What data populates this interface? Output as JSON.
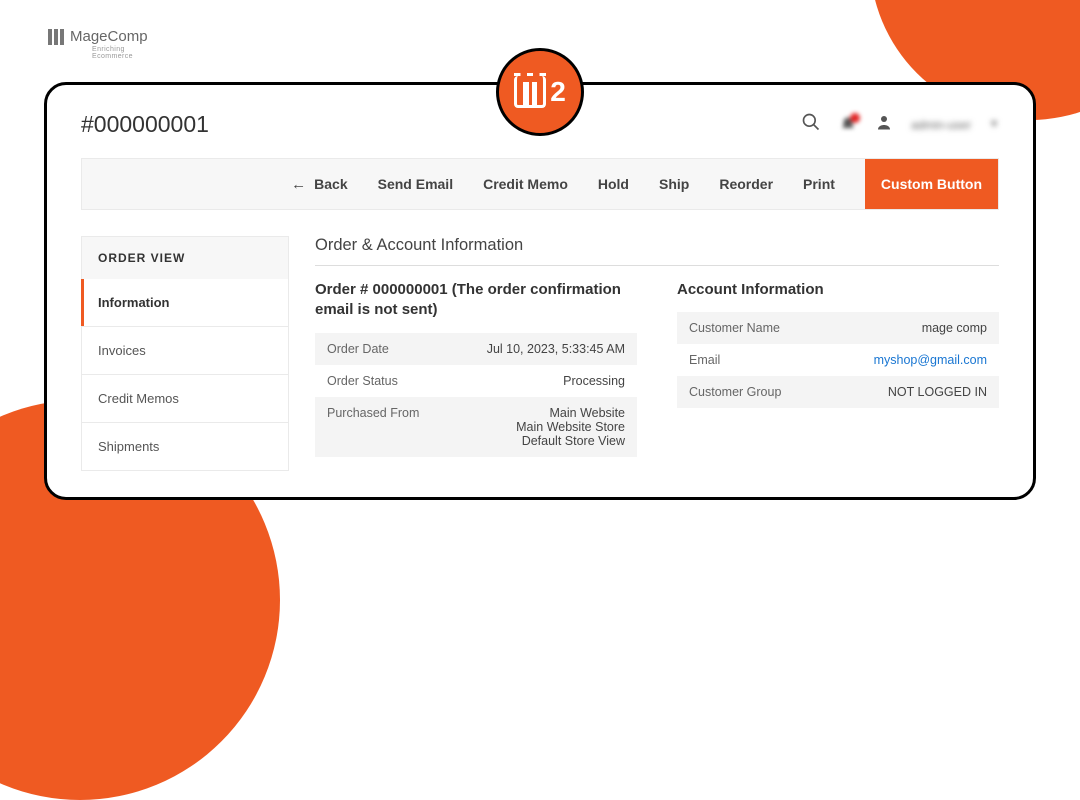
{
  "header": {
    "page_title": "#000000001",
    "user_label": "admin-user"
  },
  "badge": {
    "suffix": "2"
  },
  "logo": {
    "text": "MageComp",
    "sub": "Enriching Ecommerce"
  },
  "toolbar": {
    "back": "Back",
    "send_email": "Send Email",
    "credit_memo": "Credit Memo",
    "hold": "Hold",
    "ship": "Ship",
    "reorder": "Reorder",
    "print": "Print",
    "custom": "Custom Button"
  },
  "sidebar": {
    "header": "ORDER VIEW",
    "items": [
      {
        "label": "Information",
        "active": true
      },
      {
        "label": "Invoices"
      },
      {
        "label": "Credit Memos"
      },
      {
        "label": "Shipments"
      }
    ]
  },
  "main": {
    "section_title": "Order & Account Information",
    "order": {
      "title": "Order # 000000001 (The order confirmation email is not sent)",
      "rows": [
        {
          "label": "Order Date",
          "value": "Jul 10, 2023, 5:33:45 AM"
        },
        {
          "label": "Order Status",
          "value": "Processing"
        },
        {
          "label": "Purchased From",
          "value_lines": [
            "Main Website",
            "Main Website Store",
            "Default Store View"
          ]
        }
      ]
    },
    "account": {
      "title": "Account Information",
      "rows": [
        {
          "label": "Customer Name",
          "value": "mage comp"
        },
        {
          "label": "Email",
          "value": "myshop@gmail.com",
          "link": true
        },
        {
          "label": "Customer Group",
          "value": "NOT LOGGED IN"
        }
      ]
    }
  }
}
